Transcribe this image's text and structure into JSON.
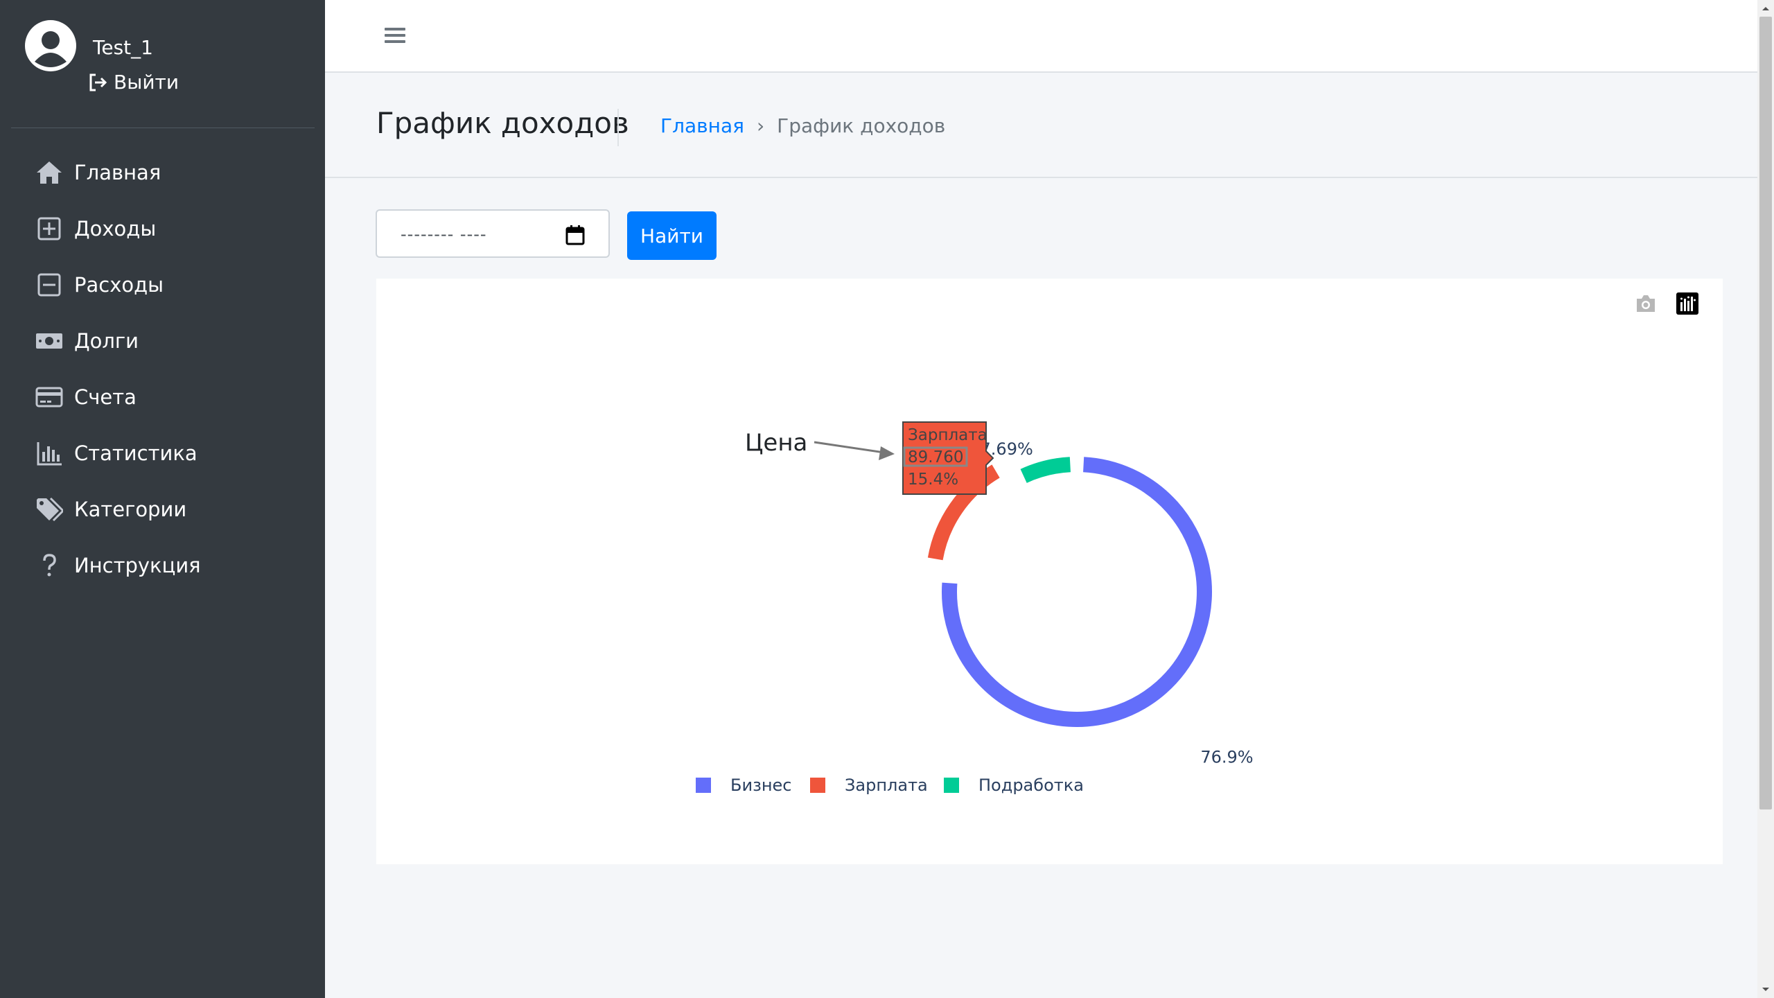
{
  "user": {
    "name": "Test_1",
    "logout_label": "Выйти"
  },
  "sidebar": {
    "items": [
      {
        "label": "Главная",
        "icon": "home-icon"
      },
      {
        "label": "Доходы",
        "icon": "plus-square-icon"
      },
      {
        "label": "Расходы",
        "icon": "minus-square-icon"
      },
      {
        "label": "Долги",
        "icon": "money-bill-icon"
      },
      {
        "label": "Счета",
        "icon": "credit-card-icon"
      },
      {
        "label": "Статистика",
        "icon": "chart-bar-icon"
      },
      {
        "label": "Категории",
        "icon": "tags-icon"
      },
      {
        "label": "Инструкция",
        "icon": "question-icon"
      }
    ]
  },
  "header": {
    "page_title": "График доходов",
    "breadcrumb": {
      "home": "Главная",
      "separator": "›",
      "current": "График доходов"
    }
  },
  "filter": {
    "date_placeholder": "-------- ----",
    "search_label": "Найти"
  },
  "colors": {
    "sidebar": "#343a40",
    "accent": "#007bff",
    "series1": "#636efa",
    "series2": "#ef553b",
    "series3": "#00cc96"
  },
  "chart_data": {
    "type": "pie",
    "hole": true,
    "labels": [
      "Бизнес",
      "Зарплата",
      "Подработка"
    ],
    "values": [
      448.8,
      89.76,
      44.88
    ],
    "percent_labels": [
      "76.9%",
      "15.4%",
      "7.69%"
    ],
    "colors": [
      "#636efa",
      "#ef553b",
      "#00cc96"
    ],
    "legend_position": "bottom",
    "hover": {
      "label": "Зарплата",
      "value": "89.760",
      "percent": "15.4%"
    },
    "annotation": "Цена"
  }
}
